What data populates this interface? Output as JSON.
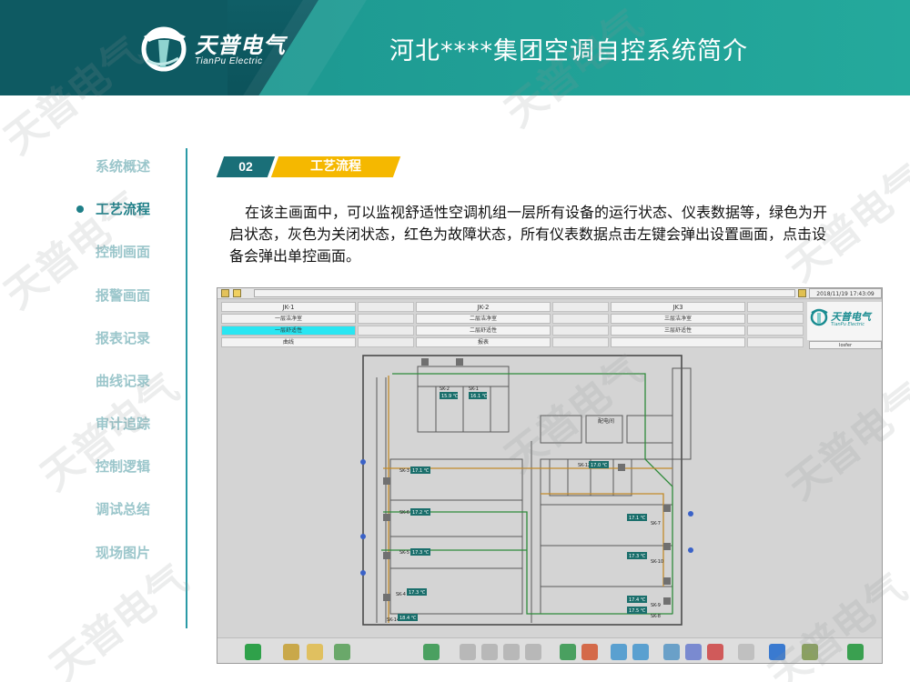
{
  "header": {
    "logo_cn": "天普电气",
    "logo_en": "TianPu Electric",
    "title": "河北****集团空调自控系统简介"
  },
  "nav": {
    "items": [
      {
        "label": "系统概述",
        "active": false
      },
      {
        "label": "工艺流程",
        "active": true
      },
      {
        "label": "控制画面",
        "active": false
      },
      {
        "label": "报警画面",
        "active": false
      },
      {
        "label": "报表记录",
        "active": false
      },
      {
        "label": "曲线记录",
        "active": false
      },
      {
        "label": "审计追踪",
        "active": false
      },
      {
        "label": "控制逻辑",
        "active": false
      },
      {
        "label": "调试总结",
        "active": false
      },
      {
        "label": "现场图片",
        "active": false
      }
    ]
  },
  "section": {
    "number": "02",
    "title": "工艺流程"
  },
  "description": "在该主画面中，可以监视舒适性空调机组一层所有设备的运行状态、仪表数据等，绿色为开启状态，灰色为关闭状态，红色为故障状态，所有仪表数据点击左键会弹出设置画面，点击设备会弹出单控画面。",
  "scada": {
    "timestamp": "2018/11/19 17:43:09",
    "user": "Iosfer",
    "columns": [
      {
        "header": "JK-1",
        "rows": [
          "一层洁净室",
          "一层舒适性",
          "曲线"
        ]
      },
      {
        "header": "JK-2",
        "rows": [
          "二层洁净室",
          "二层舒适性",
          "报表"
        ]
      },
      {
        "header": "JK3",
        "rows": [
          "三层洁净室",
          "三层舒适性",
          ""
        ]
      }
    ],
    "logo_text": "天普电气",
    "logo_en": "TianPu Electric",
    "plan_room_label": "配电间",
    "sensors": [
      {
        "id": "SK-2",
        "value": "15.9 ℃"
      },
      {
        "id": "SK-1",
        "value": "16.1 ℃"
      },
      {
        "id": "SK-3",
        "value": "17.1 ℃"
      },
      {
        "id": "SK-12",
        "value": "17.0 ℃"
      },
      {
        "id": "SK-6",
        "value": "17.2 ℃"
      },
      {
        "id": "SK-7",
        "value": "17.1 ℃"
      },
      {
        "id": "SK-5",
        "value": "17.3 ℃"
      },
      {
        "id": "SK-10",
        "value": "17.3 ℃"
      },
      {
        "id": "SK-4",
        "value": "17.3 ℃"
      },
      {
        "id": "SK-9",
        "value": "17.4 ℃"
      },
      {
        "id": "SK-8",
        "value": "17.5 ℃"
      },
      {
        "id": "SK-14",
        "value": "18.4 ℃"
      }
    ],
    "active_color": "#1f9a3c",
    "display_color": "#1b6f6c"
  },
  "watermark": "天普电气",
  "colors": {
    "header_teal": "#1f9d94",
    "header_dark": "#0e5a62",
    "nav_inactive": "#9bc6cb",
    "nav_active": "#1e7f88",
    "accent_yellow": "#f5b800"
  }
}
